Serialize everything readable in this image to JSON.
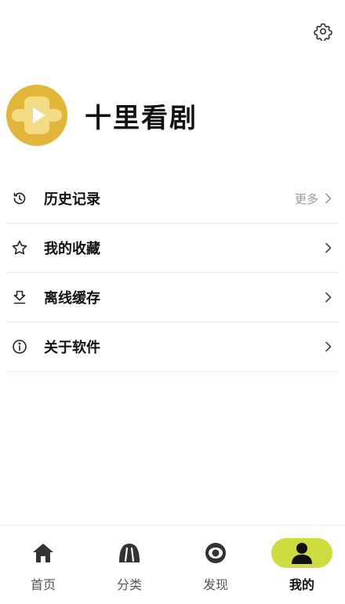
{
  "header": {
    "settings_icon": "gear-icon"
  },
  "profile": {
    "avatar_icon": "play-cross-logo",
    "name": "十里看剧",
    "colors": {
      "avatar_bg": "#e2b739"
    }
  },
  "menu": {
    "items": [
      {
        "icon": "history-icon",
        "label": "历史记录",
        "more": "更多"
      },
      {
        "icon": "star-icon",
        "label": "我的收藏"
      },
      {
        "icon": "download-icon",
        "label": "离线缓存"
      },
      {
        "icon": "info-icon",
        "label": "关于软件"
      }
    ]
  },
  "tabbar": {
    "accent": "#cddd3d",
    "tabs": [
      {
        "icon": "home-icon",
        "label": "首页",
        "active": false
      },
      {
        "icon": "category-icon",
        "label": "分类",
        "active": false
      },
      {
        "icon": "eye-icon",
        "label": "发现",
        "active": false
      },
      {
        "icon": "user-icon",
        "label": "我的",
        "active": true
      }
    ]
  }
}
